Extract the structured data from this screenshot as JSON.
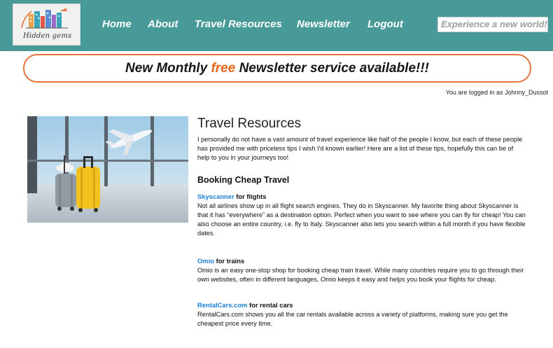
{
  "header": {
    "logo_text": "Hidden gems",
    "nav": [
      {
        "label": "Home"
      },
      {
        "label": "About"
      },
      {
        "label": "Travel Resources"
      },
      {
        "label": "Newsletter"
      },
      {
        "label": "Logout"
      }
    ],
    "search_placeholder": "Experience a new world!"
  },
  "banner": {
    "prefix": "New Monthly ",
    "highlight": "free",
    "suffix": " Newsletter service available!!!"
  },
  "login_status": "You are logged in as Johnny_Dussot",
  "main": {
    "title": "Travel Resources",
    "intro": "I personally do not have a vast amount of travel experience like half of the people I know, but each of these people has provided me with priceless tips I wish I'd known earlier!  Here are a list of these tips, hopefully this can be of help to you in your journeys too!",
    "section_title": "Booking Cheap Travel",
    "resources": [
      {
        "link": "Skyscanner",
        "suffix": "for flights",
        "description": "Not all airlines show up in all flight search engines. They do in Skyscanner. My favorite thing about Skyscanner is that it has “everywhere” as a destination option. Perfect when you want to see where you can fly for cheap! You can also choose an entire country, i.e. fly to Italy. Skyscanner also lets you search within a full month if you have flexible dates."
      },
      {
        "link": "Omio",
        "suffix": "for trains",
        "description": "Omio is an easy one-stop shop for booking cheap train travel. While many countries require you to go through their own websites, often in different languages, Omio keeps it easy and helps you book your flights for cheap."
      },
      {
        "link": "RentalCars.com",
        "suffix": "for rental cars",
        "description": "RentalCars.com shows you all the car rentals available across a variety of platforms, making sure you get the cheapest price every time."
      }
    ]
  },
  "colors": {
    "navbar": "#479a98",
    "banner_border": "#e7743a",
    "highlight": "#e8661c",
    "link": "#1e7fd0"
  }
}
